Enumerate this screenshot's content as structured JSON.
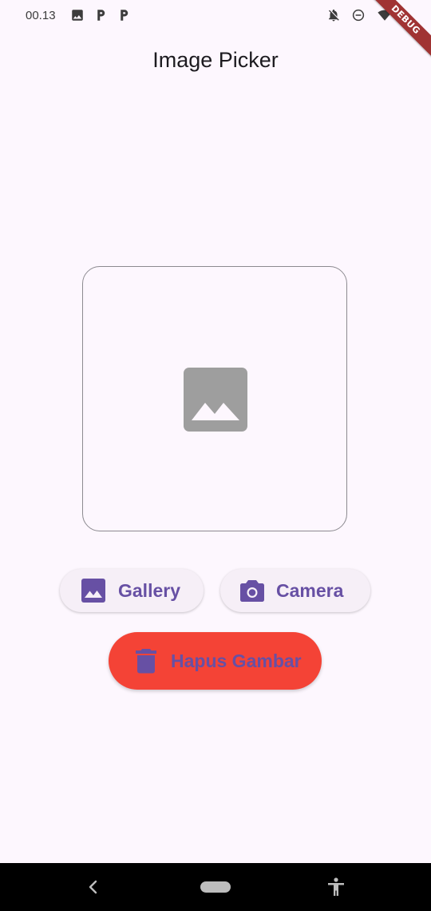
{
  "status_bar": {
    "time": "00.13",
    "left_icons": [
      "image-icon",
      "parking-icon",
      "parking-icon"
    ],
    "right_icons": [
      "notifications-off-icon",
      "do-not-disturb-icon",
      "wifi-icon"
    ]
  },
  "debug_banner": "DEBUG",
  "app_bar": {
    "title": "Image Picker"
  },
  "image_preview": {
    "icon": "image-placeholder-icon",
    "icon_color": "#9e9e9e"
  },
  "buttons": {
    "gallery": {
      "label": "Gallery",
      "icon": "photo-icon"
    },
    "camera": {
      "label": "Camera",
      "icon": "camera-icon"
    },
    "delete": {
      "label": "Hapus Gambar",
      "icon": "delete-icon",
      "background": "#f44336"
    }
  },
  "colors": {
    "accent": "#6750a4",
    "background": "#fdf7fe",
    "button_surface": "#f6eff7"
  },
  "nav_bar": {
    "icons": [
      "back-icon",
      "home-pill",
      "accessibility-icon"
    ]
  }
}
